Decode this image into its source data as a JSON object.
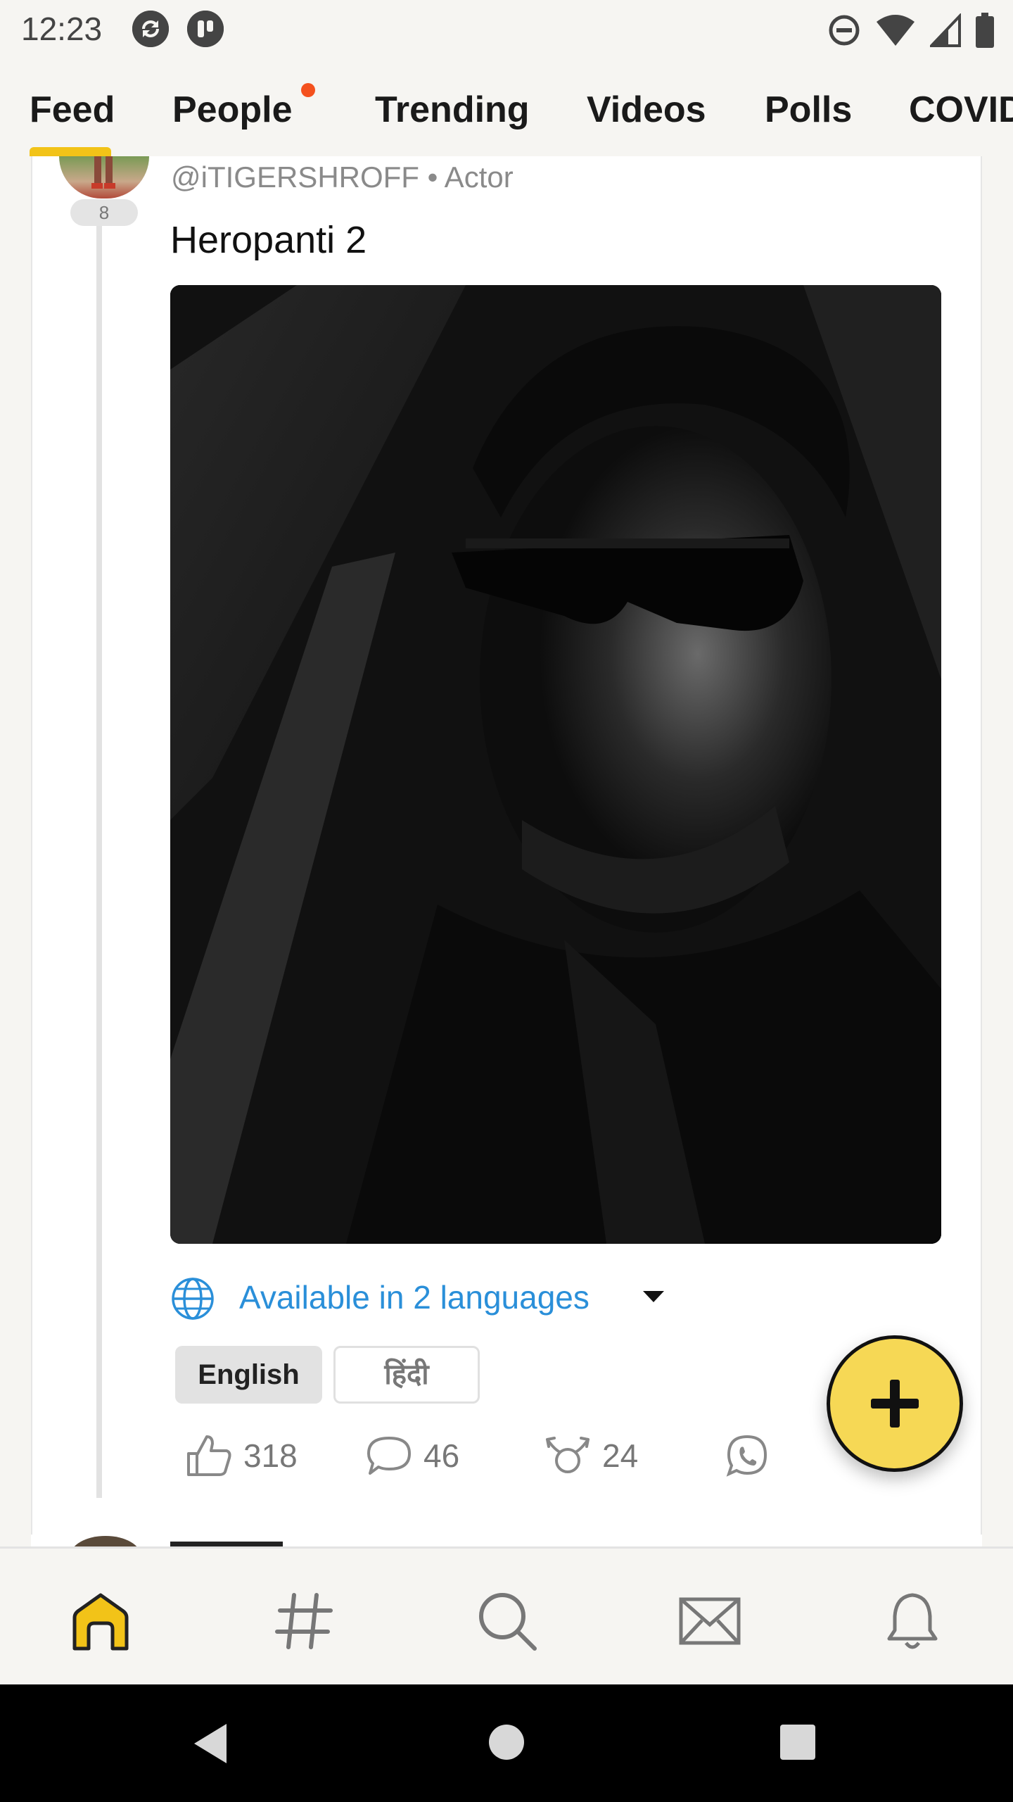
{
  "status_bar": {
    "time": "12:23",
    "icons": [
      "sync-icon",
      "app-icon",
      "dnd-icon",
      "wifi-icon",
      "signal-icon",
      "battery-icon"
    ]
  },
  "tabs": {
    "items": [
      {
        "label": "Feed",
        "active": true
      },
      {
        "label": "People",
        "has_dot": true
      },
      {
        "label": "Trending"
      },
      {
        "label": "Videos"
      },
      {
        "label": "Polls"
      },
      {
        "label": "COVID"
      }
    ],
    "accent_color": "#f2c318",
    "dot_color": "#f4511e"
  },
  "post": {
    "avatar_badge": "8",
    "handle": "@iTIGERSHROFF • Actor",
    "title": "Heropanti 2",
    "languages_label": "Available in 2 languages",
    "language_chips": [
      "English",
      "हिंदी"
    ],
    "actions": {
      "likes": "318",
      "comments": "46",
      "rekoos": "24"
    }
  },
  "bottom_nav": {
    "items": [
      "home-icon",
      "hashtag-icon",
      "search-icon",
      "mail-icon",
      "bell-icon"
    ],
    "active_color": "#f2c318"
  },
  "colors": {
    "link_blue": "#2a8fd9",
    "fab_yellow": "#f6d855"
  }
}
